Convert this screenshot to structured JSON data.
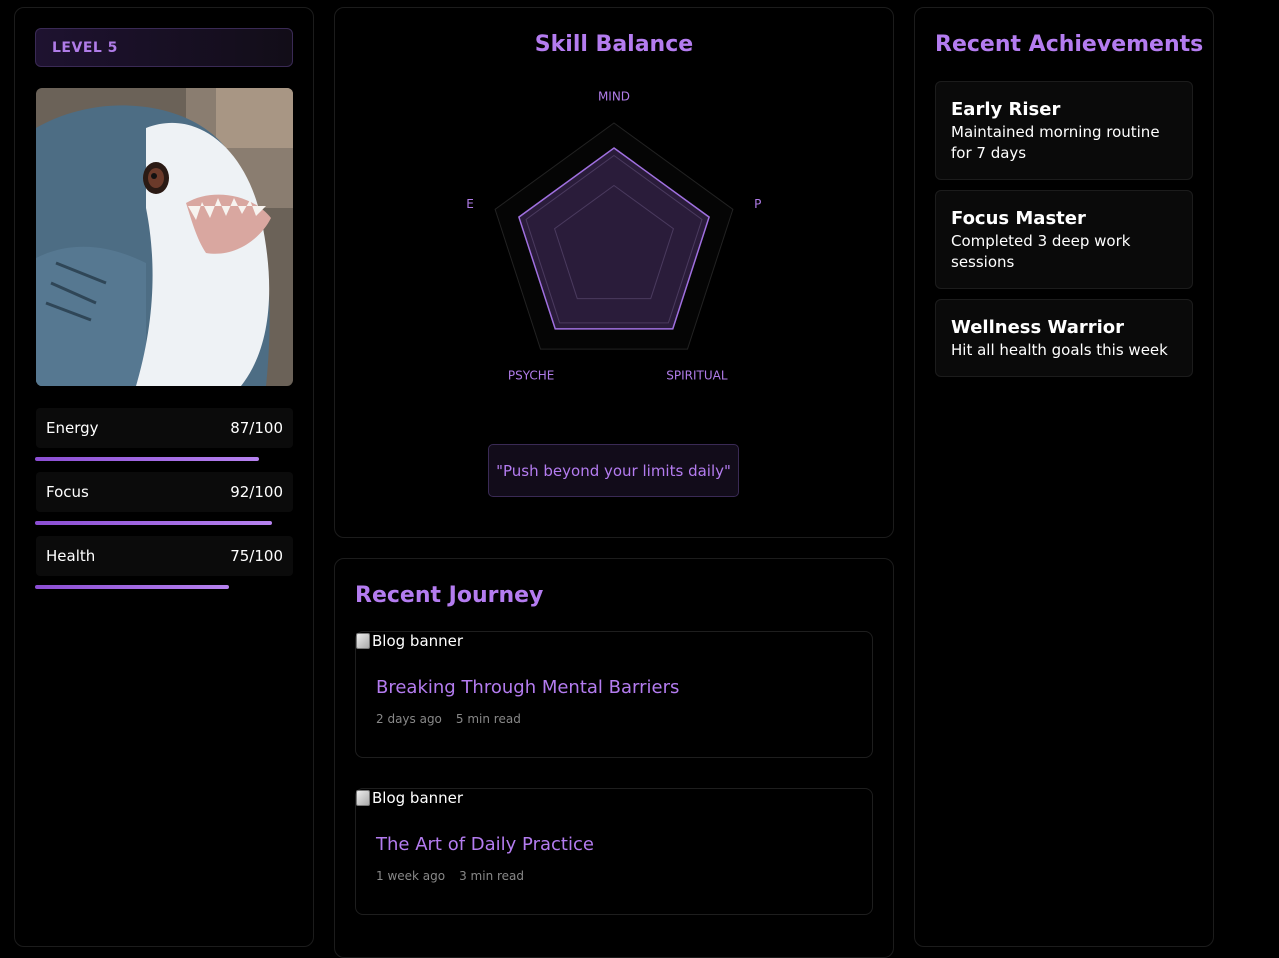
{
  "profile": {
    "level_label": "LEVEL 5",
    "stats": [
      {
        "label": "Energy",
        "value": "87/100",
        "fraction": 0.87
      },
      {
        "label": "Focus",
        "value": "92/100",
        "fraction": 0.92
      },
      {
        "label": "Health",
        "value": "75/100",
        "fraction": 0.75
      }
    ]
  },
  "skill": {
    "title": "Skill Balance",
    "axes": [
      "MIND",
      "P",
      "SPIRITUAL",
      "PSYCHE",
      "E"
    ],
    "quote": "\"Push beyond your limits daily\""
  },
  "chart_data": {
    "type": "radar",
    "title": "Skill Balance",
    "axes": [
      "MIND",
      "P",
      "SPIRITUAL",
      "PSYCHE",
      "E"
    ],
    "series": [
      {
        "values": [
          0.8,
          0.8,
          0.8,
          0.8,
          0.8
        ]
      }
    ],
    "max": 1,
    "rings": [
      0.5,
      0.75,
      1.0
    ],
    "accent": "#a070e0"
  },
  "journey": {
    "title": "Recent Journey",
    "posts": [
      {
        "banner_alt": "Blog banner",
        "title": "Breaking Through Mental Barriers",
        "date": "2 days ago",
        "read": "5 min read"
      },
      {
        "banner_alt": "Blog banner",
        "title": "The Art of Daily Practice",
        "date": "1 week ago",
        "read": "3 min read"
      }
    ]
  },
  "achievements": {
    "title": "Recent Achievements",
    "items": [
      {
        "title": "Early Riser",
        "desc": "Maintained morning routine for 7 days"
      },
      {
        "title": "Focus Master",
        "desc": "Completed 3 deep work sessions"
      },
      {
        "title": "Wellness Warrior",
        "desc": "Hit all health goals this week"
      }
    ]
  },
  "colors": {
    "accent": "#b47cf0",
    "background": "#000000"
  }
}
